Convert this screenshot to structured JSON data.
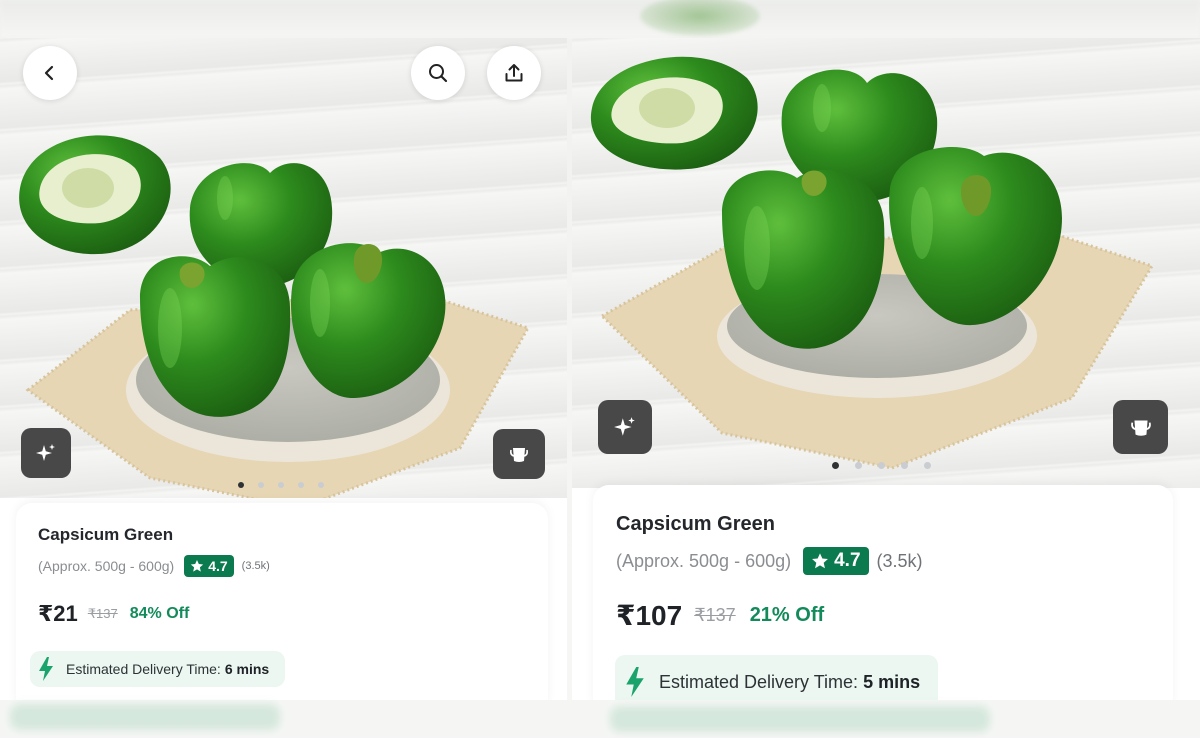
{
  "screens": [
    {
      "product": {
        "name": "Capsicum Green",
        "weight": "(Approx. 500g - 600g)",
        "rating": "4.7",
        "rating_count": "(3.5k)",
        "price": "₹21",
        "mrp": "₹137",
        "discount": "84% Off"
      },
      "delivery": {
        "label": "Estimated Delivery Time:",
        "value": "6 mins"
      },
      "carousel": {
        "count": 5,
        "active": 1
      }
    },
    {
      "product": {
        "name": "Capsicum Green",
        "weight": "(Approx. 500g - 600g)",
        "rating": "4.7",
        "rating_count": "(3.5k)",
        "price": "₹107",
        "mrp": "₹137",
        "discount": "21% Off"
      },
      "delivery": {
        "label": "Estimated Delivery Time:",
        "value": "5 mins"
      },
      "carousel": {
        "count": 5,
        "active": 1
      }
    }
  ],
  "icons": {
    "back": "back-arrow-icon",
    "search": "search-icon",
    "share": "share-icon",
    "ai": "sparkle-icon",
    "cup": "cup-icon",
    "star": "star-icon",
    "bolt": "lightning-bolt-icon"
  },
  "colors": {
    "rating_badge": "#0c7a4f",
    "discount_text": "#128a5a",
    "delivery_bolt": "#1aa36b",
    "delivery_bg": "#ecf7f1",
    "pepper_green": "#2f8a1f"
  }
}
